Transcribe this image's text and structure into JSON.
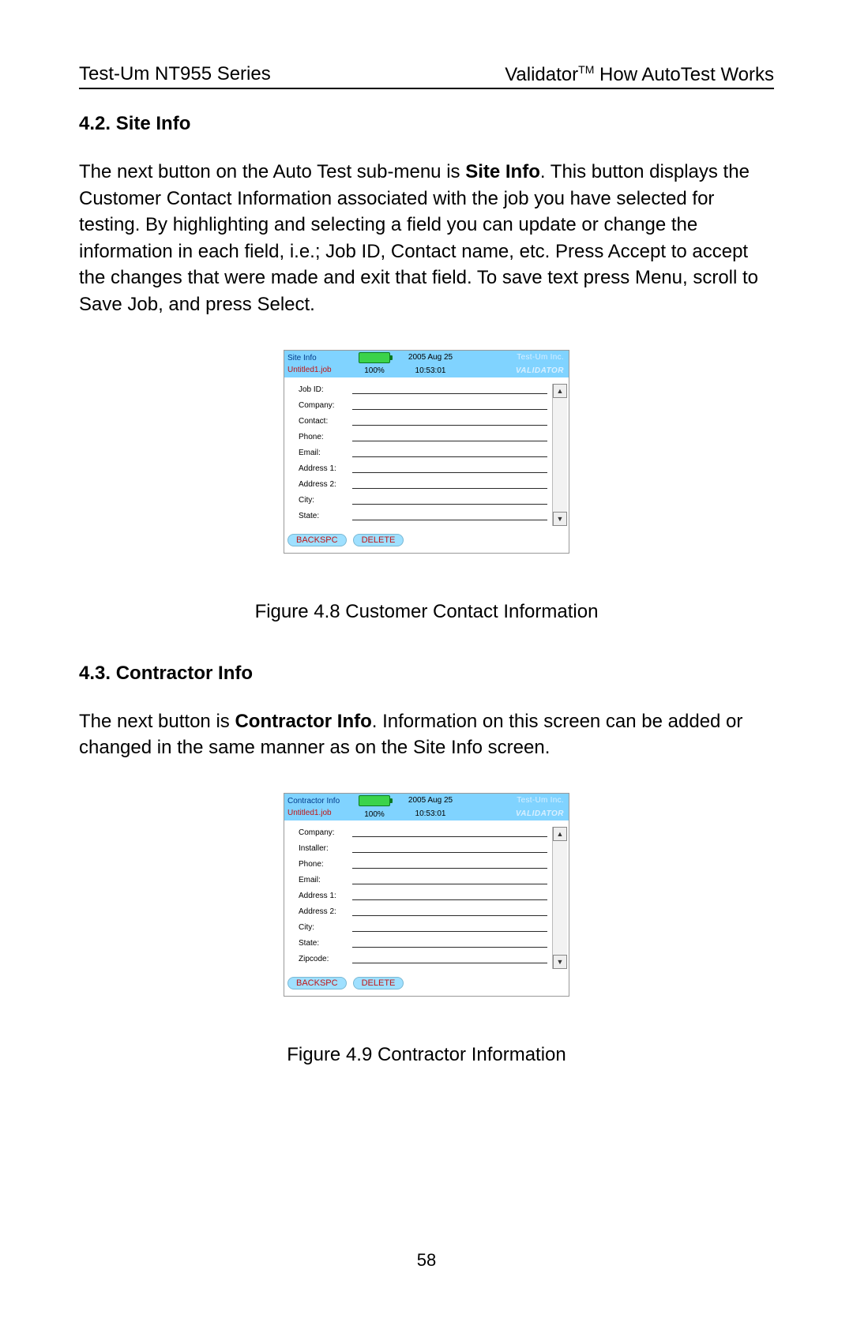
{
  "page": {
    "header_left": "Test-Um NT955 Series",
    "header_right_a": "Validator",
    "header_right_tm": "TM",
    "header_right_b": " How AutoTest Works",
    "number": "58"
  },
  "sections": {
    "s42": {
      "title": "4.2. Site Info",
      "para_a": "The next button on the Auto Test sub-menu is ",
      "para_b_bold": "Site Info",
      "para_c": ".  This button displays the Customer Contact Information associated with the job you have selected for testing.  By highlighting and selecting a field you can update or change the information in each field, i.e.; Job ID, Contact name, etc.  Press Accept to accept the changes that were made and exit that field.  To save text press Menu, scroll to Save Job, and press Select."
    },
    "s43": {
      "title": "4.3. Contractor Info",
      "para_a": "The next button is ",
      "para_b_bold": "Contractor Info",
      "para_c": ".  Information on this screen can be added or changed in the same manner as on the Site Info screen."
    }
  },
  "captions": {
    "fig48": "Figure 4.8 Customer Contact Information",
    "fig49": "Figure 4.9 Contractor Information"
  },
  "device_common": {
    "jobfile": "Untitled1.job",
    "battery_pct": "100%",
    "date": "2005 Aug 25",
    "time": "10:53:01",
    "brand_top": "Test-Um Inc.",
    "brand_bottom": "VALIDATOR",
    "btn_backspc": "BACKSPC",
    "btn_delete": "DELETE",
    "arrow_up": "▲",
    "arrow_down": "▼"
  },
  "device1": {
    "title": "Site Info",
    "labels": [
      "Job ID:",
      "Company:",
      "Contact:",
      "Phone:",
      "Email:",
      "Address 1:",
      "Address 2:",
      "City:",
      "State:"
    ]
  },
  "device2": {
    "title": "Contractor Info",
    "labels": [
      "Company:",
      "Installer:",
      "Phone:",
      "Email:",
      "Address 1:",
      "Address 2:",
      "City:",
      "State:",
      "Zipcode:"
    ]
  }
}
